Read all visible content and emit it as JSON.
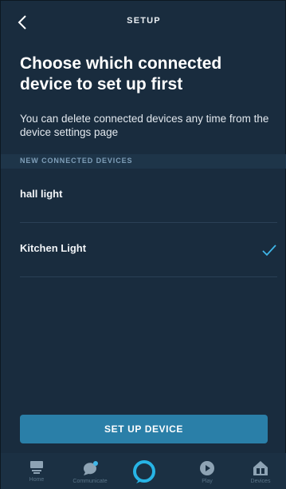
{
  "header": {
    "title": "SETUP"
  },
  "headline": "Choose which connected device to set up first",
  "subtext": "You can delete connected devices any time from the device settings page",
  "section_label": "NEW CONNECTED DEVICES",
  "devices": [
    {
      "label": "hall light",
      "selected": false
    },
    {
      "label": "Kitchen Light",
      "selected": true
    }
  ],
  "cta_label": "SET UP DEVICE",
  "nav": {
    "home": {
      "label": "Home",
      "icon": "home-icon"
    },
    "communicate": {
      "label": "Communicate",
      "icon": "chat-bubble-icon"
    },
    "alexa": {
      "icon": "alexa-ring-icon"
    },
    "play": {
      "label": "Play",
      "icon": "play-icon"
    },
    "devices": {
      "label": "Devices",
      "icon": "devices-house-icon"
    }
  },
  "colors": {
    "background": "#192c3e",
    "accent": "#2a7fa8",
    "check": "#3fb6e8",
    "alexa": "#27b4e6"
  }
}
